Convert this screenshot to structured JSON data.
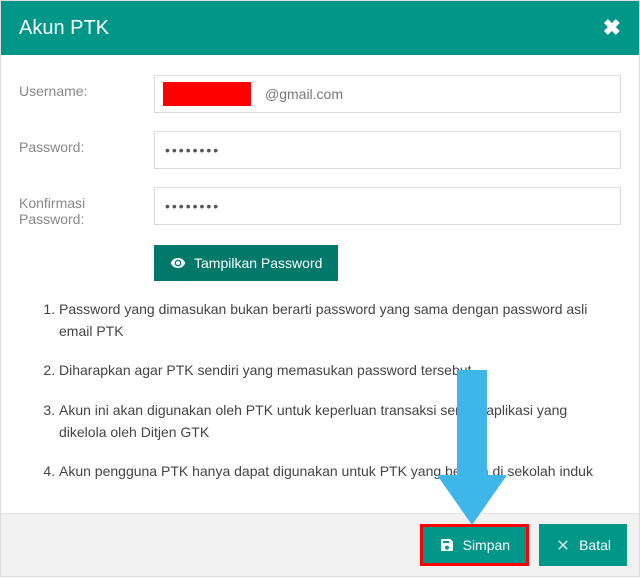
{
  "header": {
    "title": "Akun PTK"
  },
  "form": {
    "username_label": "Username:",
    "username_suffix": "@gmail.com",
    "password_label": "Password:",
    "password_value": "••••••••",
    "confirm_label": "Konfirmasi Password:",
    "confirm_value": "••••••••",
    "show_password_label": "Tampilkan Password"
  },
  "notes": [
    "Password yang dimasukan bukan berarti password yang sama dengan password asli email PTK",
    "Diharapkan agar PTK sendiri yang memasukan password tersebut",
    "Akun ini akan digunakan oleh PTK untuk keperluan transaksi semua aplikasi yang dikelola oleh Ditjen GTK",
    "Akun pengguna PTK hanya dapat digunakan untuk PTK yang berada di sekolah induk"
  ],
  "footer": {
    "save_label": "Simpan",
    "cancel_label": "Batal"
  },
  "colors": {
    "teal": "#009688",
    "teal_dark": "#00796b",
    "arrow": "#3fb6e8",
    "highlight": "#ff0000"
  }
}
